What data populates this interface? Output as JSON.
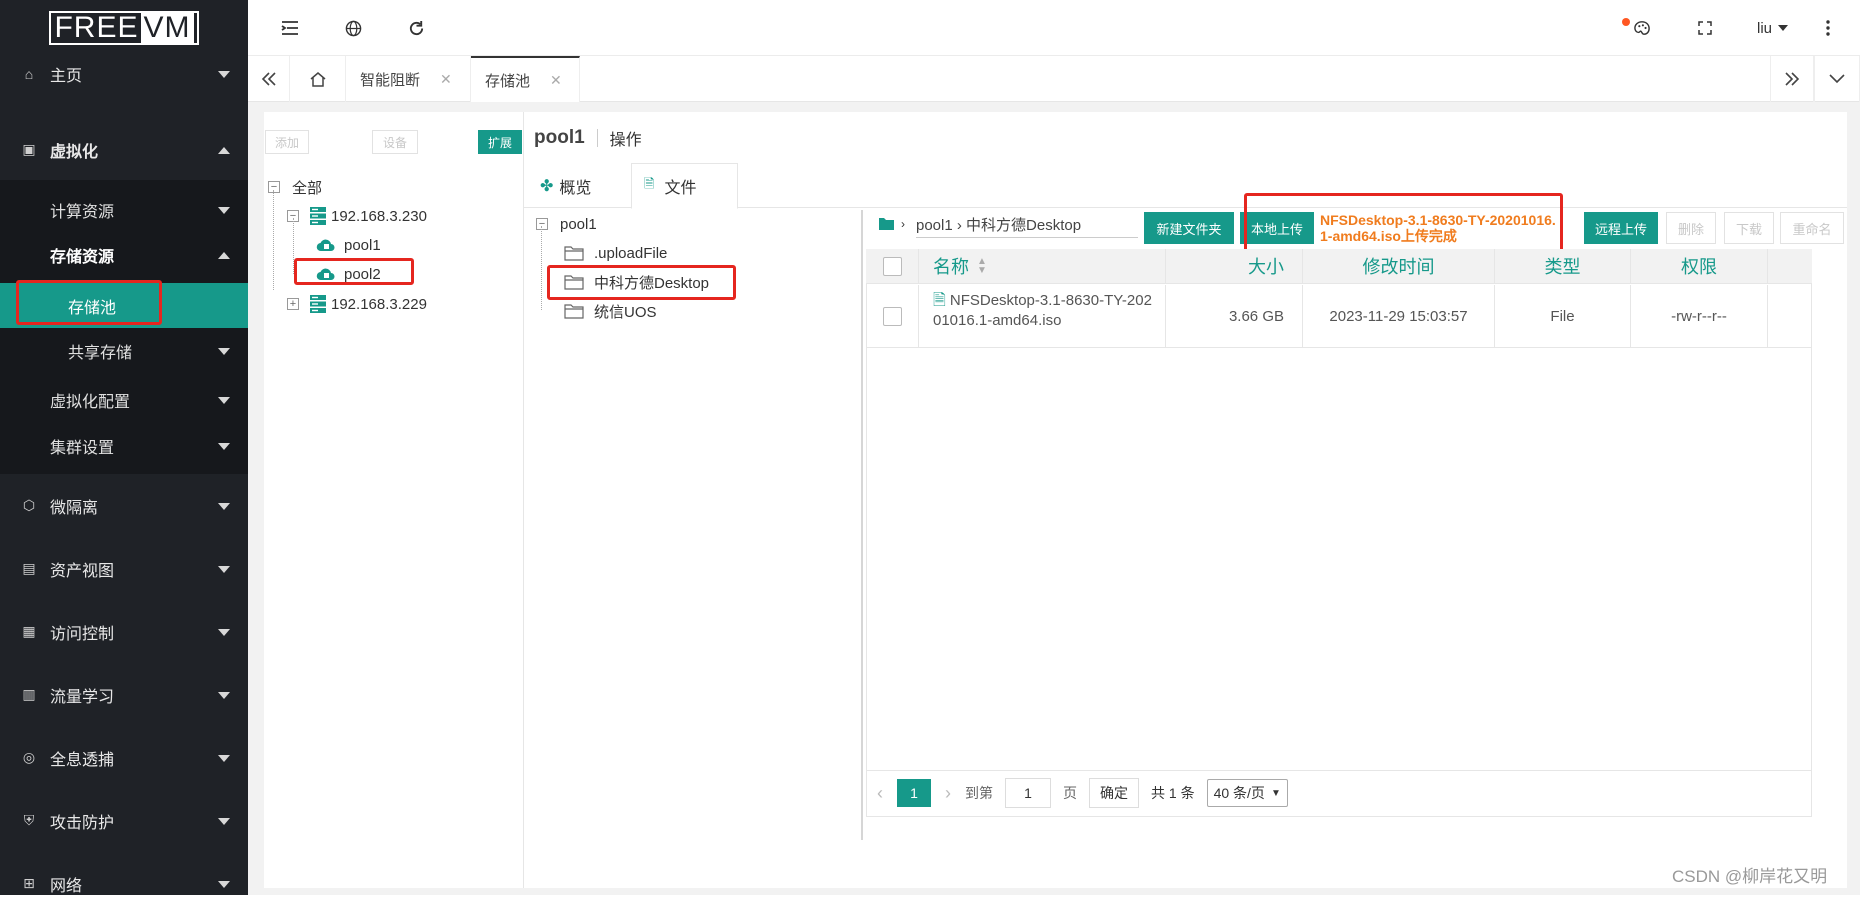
{
  "logo": {
    "free": "FREE",
    "vm": "VM"
  },
  "sidebar": {
    "items": [
      {
        "label": "主页",
        "icon": "home-icon"
      },
      {
        "label": "虚拟化",
        "icon": "virtualization-icon"
      },
      {
        "label": "微隔离",
        "icon": "cube-icon"
      },
      {
        "label": "资产视图",
        "icon": "asset-icon"
      },
      {
        "label": "访问控制",
        "icon": "grid-icon"
      },
      {
        "label": "流量学习",
        "icon": "traffic-icon"
      },
      {
        "label": "全息透捕",
        "icon": "target-icon"
      },
      {
        "label": "攻击防护",
        "icon": "shield-icon"
      },
      {
        "label": "网络",
        "icon": "network-icon"
      }
    ],
    "sub": {
      "compute": "计算资源",
      "storage": "存储资源",
      "pool": "存储池",
      "shared": "共享存储",
      "virt_config": "虚拟化配置",
      "cluster": "集群设置"
    }
  },
  "header": {
    "user": "liu"
  },
  "tabs": [
    {
      "label": "智能阻断"
    },
    {
      "label": "存储池"
    }
  ],
  "left_tree": {
    "buttons": {
      "add": "添加",
      "settings": "设备",
      "expand": "扩展"
    },
    "root": "全部",
    "hosts": [
      {
        "label": "192.168.3.230",
        "pools": [
          "pool1",
          "pool2"
        ]
      },
      {
        "label": "192.168.3.229"
      }
    ]
  },
  "detail": {
    "title": "pool1",
    "action": "操作",
    "tabs": {
      "overview": "概览",
      "files": "文件"
    }
  },
  "folder_tree": {
    "root": "pool1",
    "children": [
      ".uploadFile",
      "中科方德Desktop",
      "统信UOS"
    ]
  },
  "toolbar": {
    "path": "pool1 › 中科方德Desktop",
    "new_folder": "新建文件夹",
    "local_upload": "本地上传",
    "upload_msg": "NFSDesktop-3.1-8630-TY-20201016.1-amd64.iso上传完成",
    "remote_upload": "远程上传",
    "delete": "删除",
    "download": "下载",
    "rename": "重命名"
  },
  "table": {
    "headers": {
      "name": "名称",
      "size": "大小",
      "mtime": "修改时间",
      "type": "类型",
      "perm": "权限"
    },
    "rows": [
      {
        "name": "NFSDesktop-3.1-8630-TY-20201016.1-amd64.iso",
        "size": "3.66 GB",
        "mtime": "2023-11-29 15:03:57",
        "type": "File",
        "perm": "-rw-r--r--"
      }
    ]
  },
  "pager": {
    "current": "1",
    "goto": "到第",
    "page_input": "1",
    "page_unit": "页",
    "confirm": "确定",
    "total": "共 1 条",
    "size_option": "40 条/页"
  },
  "watermark": "CSDN @柳岸花又明",
  "colors": {
    "teal": "#16998a",
    "sidebar": "#1f2227",
    "highlight": "#e5261f",
    "message": "#f07c1e"
  }
}
